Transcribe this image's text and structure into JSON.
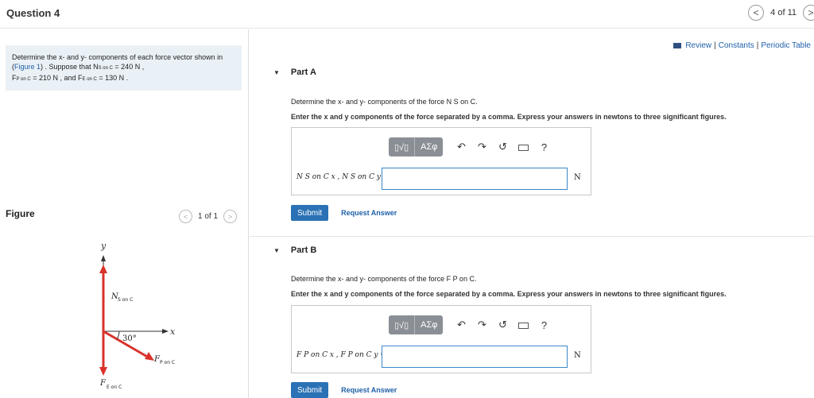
{
  "header": {
    "title": "Question 4",
    "position": "4 of 11",
    "prev_glyph": "<",
    "next_glyph": ">"
  },
  "prompt": {
    "text1": "Determine the x- and y- components of each force vector shown in (",
    "link": "Figure 1",
    "text2": ") . Suppose that N",
    "n_sub": "S on C",
    "text3": " = 240  N ,",
    "fp": "F",
    "fp_sub": "P on C",
    "text4": " = 210  N , and F",
    "fe_sub": "E on C",
    "text5": " = 130  N ."
  },
  "figure": {
    "label": "Figure",
    "count": "1 of 1",
    "y_axis": "y",
    "x_axis": "x",
    "n_label": "N",
    "n_sub": "S on C",
    "fp_label": "F",
    "fp_sub": "P on C",
    "fe_label": "F",
    "fe_sub": "E on C",
    "angle": "30°"
  },
  "links": {
    "review": "Review",
    "constants": "Constants",
    "periodic": "Periodic Table",
    "sep": "|"
  },
  "parts": [
    {
      "title": "Part A",
      "question": "Determine the x- and y- components of the force N S on C.",
      "instruction": "Enter the x and y components of the force separated by a comma. Express your answers in newtons to three significant figures.",
      "eq_label": "N S on C x , N S on C y =",
      "unit": "N",
      "submit": "Submit",
      "request": "Request Answer"
    },
    {
      "title": "Part B",
      "question": "Determine the x- and y- components of the force F P on C.",
      "instruction": "Enter the x and y components of the force separated by a comma. Express your answers in newtons to three significant figures.",
      "eq_label": "F P on C x , F P on C y =",
      "unit": "N",
      "submit": "Submit",
      "request": "Request Answer"
    }
  ],
  "toolbar": {
    "templates": "▯√▯",
    "greek": "ΑΣφ",
    "undo": "↶",
    "redo": "↷",
    "reset": "↺",
    "help": "?"
  }
}
